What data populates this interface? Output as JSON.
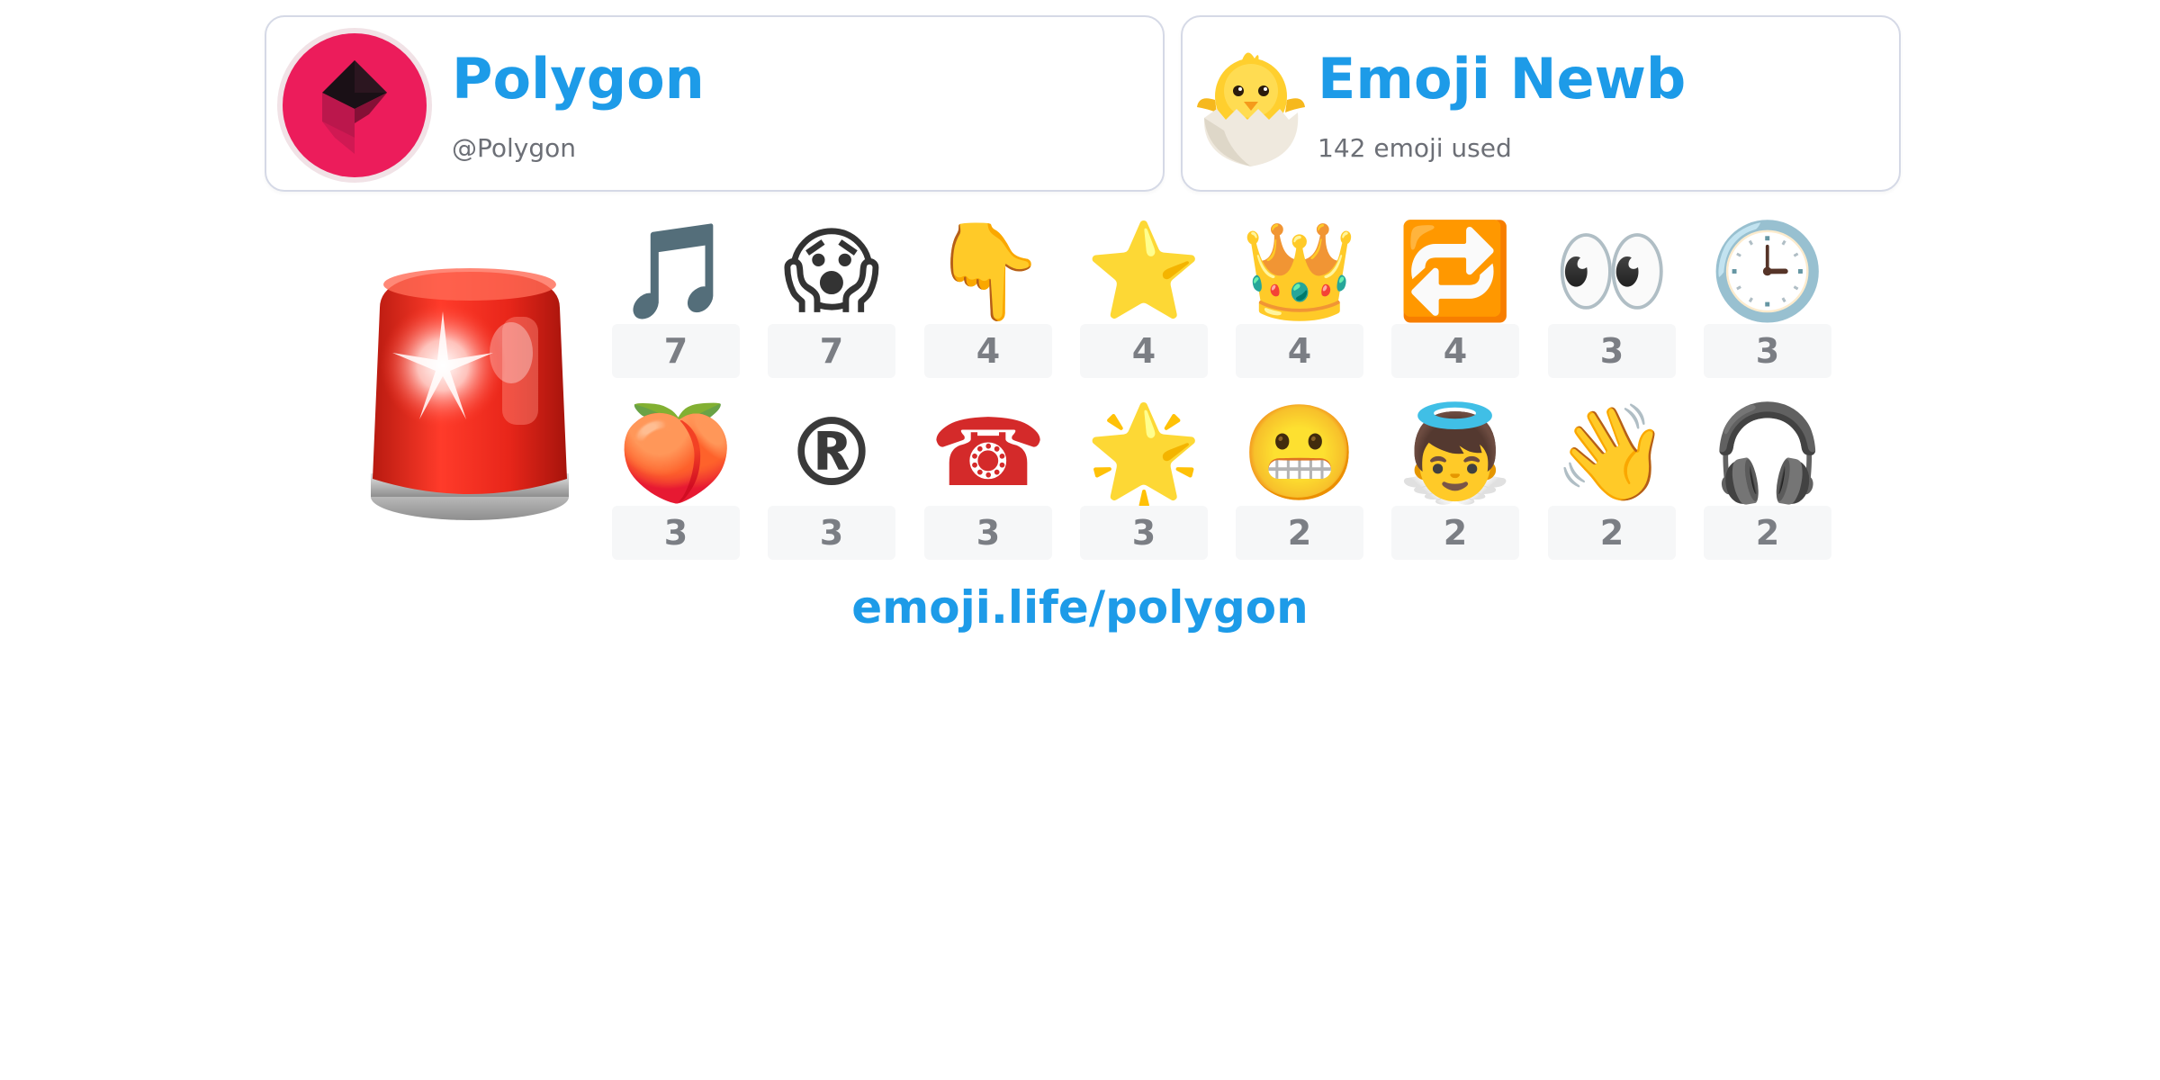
{
  "profile": {
    "name": "Polygon",
    "handle": "@Polygon",
    "avatar_icon": "polygon-logo",
    "avatar_color": "#ec1c5b"
  },
  "rank": {
    "title": "Emoji Newb",
    "subtitle": "142 emoji used",
    "icon": "hatching-chick"
  },
  "featured_emoji": {
    "name": "police-car-light",
    "glyph": "🚨"
  },
  "top_emoji": [
    {
      "name": "musical-note",
      "glyph": "🎵",
      "count": "7"
    },
    {
      "name": "face-screaming-in-fear",
      "glyph": "😱",
      "count": "7"
    },
    {
      "name": "backhand-index-pointing-down",
      "glyph": "👇",
      "count": "4"
    },
    {
      "name": "star",
      "glyph": "⭐",
      "count": "4"
    },
    {
      "name": "crown",
      "glyph": "👑",
      "count": "4"
    },
    {
      "name": "repeat-button",
      "glyph": "🔁",
      "count": "4"
    },
    {
      "name": "eyes",
      "glyph": "👀",
      "count": "3"
    },
    {
      "name": "three-oclock",
      "glyph": "🕒",
      "count": "3"
    },
    {
      "name": "peach",
      "glyph": "🍑",
      "count": "3"
    },
    {
      "name": "registered",
      "glyph": "®",
      "count": "3"
    },
    {
      "name": "telephone",
      "glyph": "☎",
      "count": "3"
    },
    {
      "name": "glowing-star",
      "glyph": "🌟",
      "count": "3"
    },
    {
      "name": "grimacing-face",
      "glyph": "😬",
      "count": "2"
    },
    {
      "name": "baby-angel",
      "glyph": "👼",
      "count": "2"
    },
    {
      "name": "waving-hand",
      "glyph": "👋",
      "count": "2"
    },
    {
      "name": "headphone",
      "glyph": "🎧",
      "count": "2"
    }
  ],
  "footer": {
    "link": "emoji.life/polygon"
  },
  "colors": {
    "accent": "#1d9be8",
    "card_border": "#d5d9e6",
    "count_bg": "#f6f7f8",
    "count_text": "#7b7e84"
  }
}
